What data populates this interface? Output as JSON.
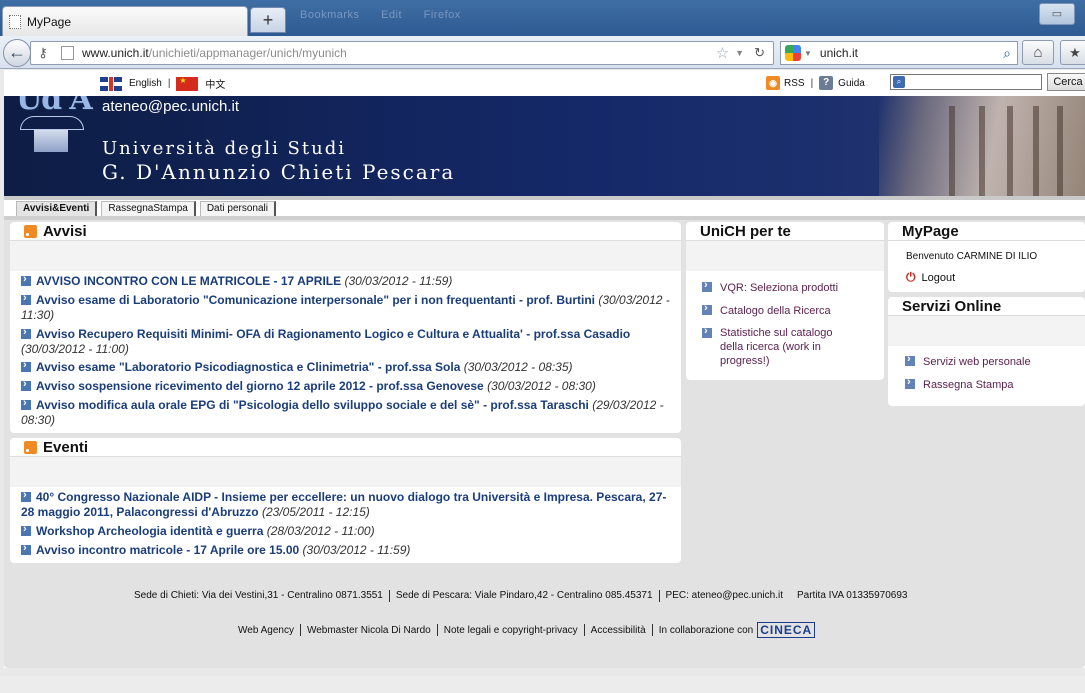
{
  "browser": {
    "tab_title": "MyPage",
    "new_tab": "+",
    "ghost_menu": [
      "Bookmarks",
      "Edit",
      "Firefox"
    ],
    "url_host": "www.unich.it",
    "url_path": "/unichieti/appmanager/unich/myunich",
    "search_query": "unich.it"
  },
  "toolbar": {
    "lang_en": "English",
    "lang_zh": "中文",
    "rss": "RSS",
    "help": "Guida",
    "search_button": "Cerca"
  },
  "banner": {
    "pec": "ateneo@pec.unich.it",
    "uni_line1": "Università degli Studi",
    "uni_line2": "G. D'Annunzio Chieti Pescara",
    "logo_text": "Ud'A"
  },
  "tabs": [
    "Avvisi&Eventi",
    "RassegnaStampa",
    "Dati personali"
  ],
  "avvisi": {
    "title": "Avvisi",
    "items": [
      {
        "t": "AVVISO INCONTRO CON LE MATRICOLE - 17 APRILE",
        "d": "(30/03/2012 - 11:59)"
      },
      {
        "t": "Avviso esame di Laboratorio \"Comunicazione interpersonale\" per i non frequentanti - prof. Burtini",
        "d": "(30/03/2012 - 11:30)"
      },
      {
        "t": "Avviso Recupero Requisiti Minimi- OFA di Ragionamento Logico e Cultura e Attualita' - prof.ssa Casadio",
        "d": "(30/03/2012 - 11:00)"
      },
      {
        "t": "Avviso esame \"Laboratorio Psicodiagnostica e Clinimetria\" - prof.ssa Sola",
        "d": "(30/03/2012 - 08:35)"
      },
      {
        "t": "Avviso sospensione ricevimento del giorno 12 aprile 2012 - prof.ssa Genovese",
        "d": "(30/03/2012 - 08:30)"
      },
      {
        "t": "Avviso modifica aula orale EPG di \"Psicologia dello sviluppo sociale e del sè\" - prof.ssa Taraschi",
        "d": "(29/03/2012 - 08:30)"
      }
    ]
  },
  "eventi": {
    "title": "Eventi",
    "items": [
      {
        "t": "40° Congresso Nazionale AIDP - Insieme per eccellere: un nuovo dialogo tra Università e Impresa. Pescara, 27-28 maggio 2011, Palacongressi d'Abruzzo",
        "d": "(23/05/2011 - 12:15)"
      },
      {
        "t": "Workshop Archeologia identità e guerra",
        "d": "(28/03/2012 - 11:00)"
      },
      {
        "t": "Avviso incontro matricole - 17 Aprile ore 15.00",
        "d": "(30/03/2012 - 11:59)"
      }
    ]
  },
  "unich": {
    "title": "UniCH per te",
    "items": [
      "VQR: Seleziona prodotti",
      "Catalogo della Ricerca",
      "Statistiche sul catalogo della ricerca (work in progress!)"
    ]
  },
  "mypage": {
    "title": "MyPage",
    "welcome": "Benvenuto CARMINE DI ILIO",
    "logout": "Logout"
  },
  "servizi": {
    "title": "Servizi Online",
    "items": [
      "Servizi web personale",
      "Rassegna Stampa"
    ]
  },
  "footer": {
    "chieti": "Sede di Chieti: Via dei Vestini,31 - Centralino 0871.3551",
    "pescara": "Sede di Pescara: Viale Pindaro,42 - Centralino 085.45371",
    "pec": "PEC: ateneo@pec.unich.it",
    "piva": "Partita IVA 01335970693",
    "web_agency": "Web Agency",
    "webmaster": "Webmaster Nicola Di Nardo",
    "legal": "Note legali e copyright-privacy",
    "access": "Accessibilità",
    "collab": "In collaborazione con",
    "cineca": "CINECA"
  }
}
